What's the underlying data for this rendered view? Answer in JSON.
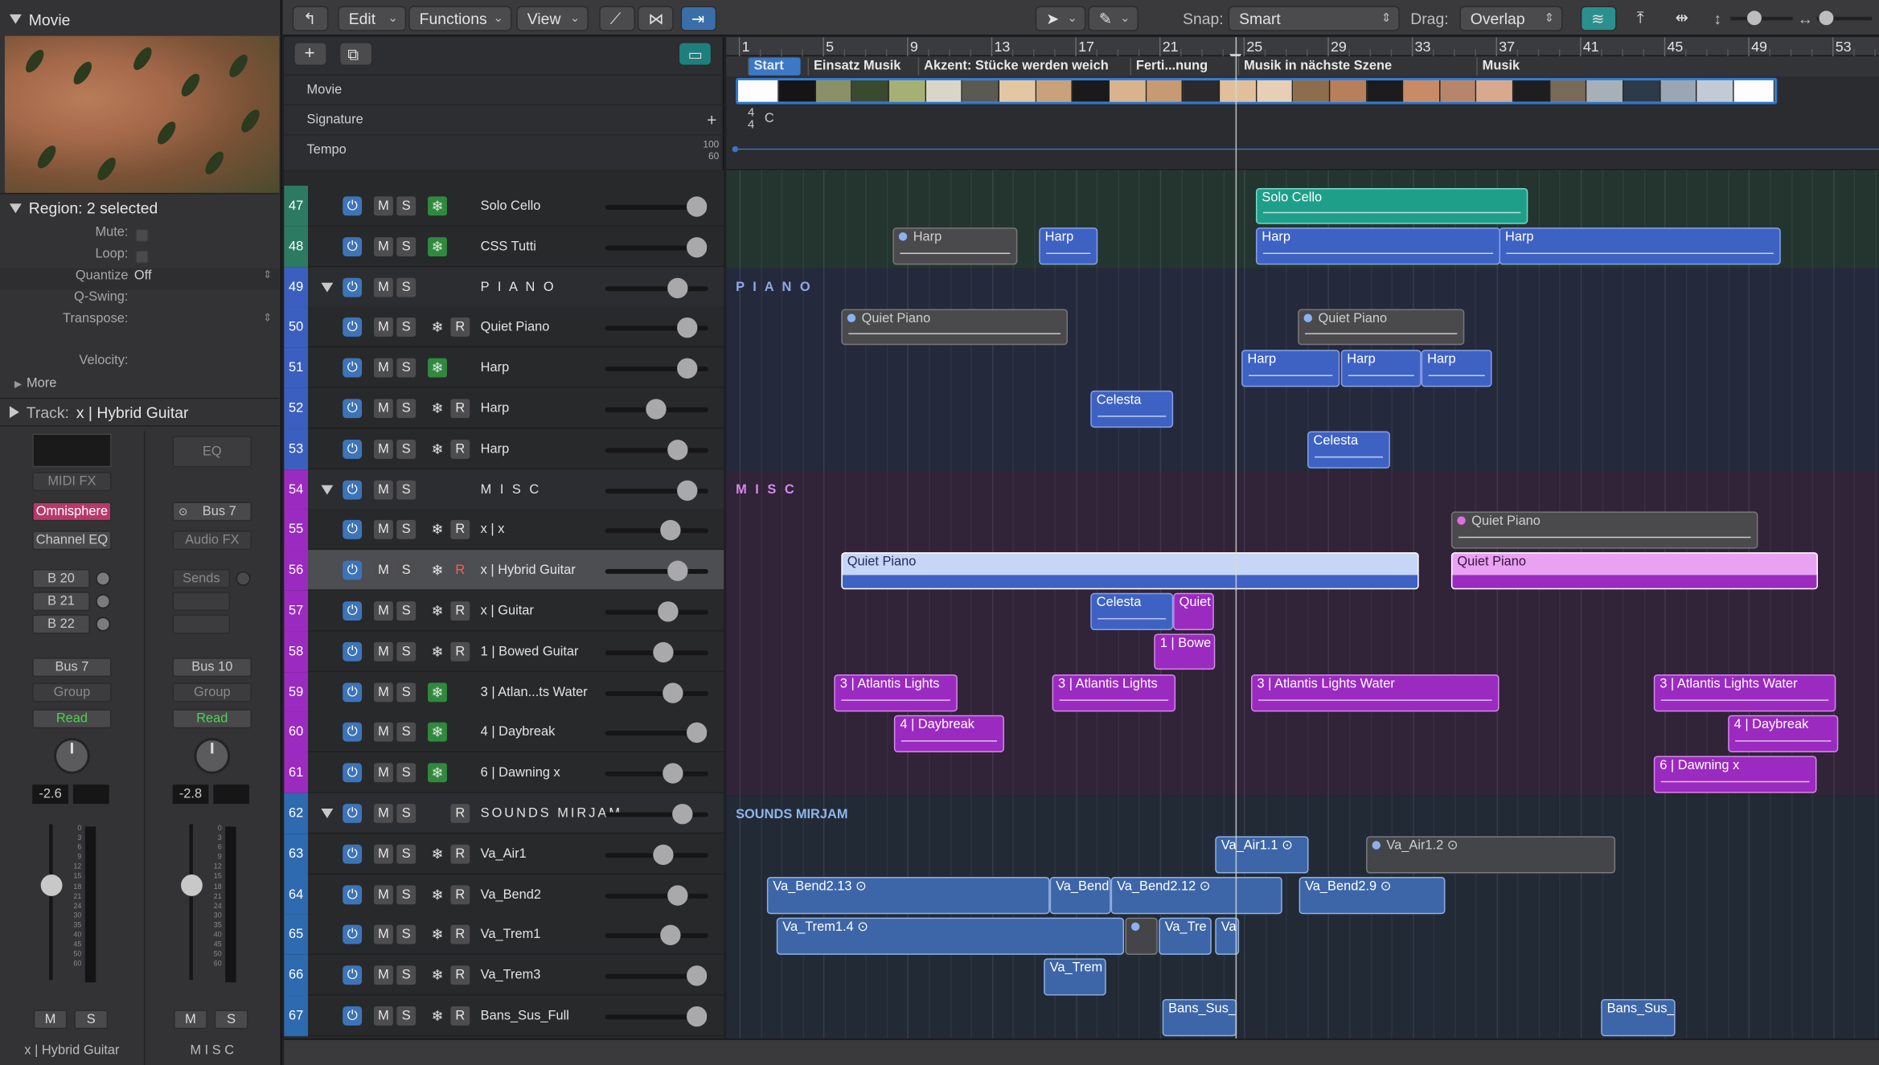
{
  "inspector": {
    "movie_title": "Movie",
    "region_label": "Region: 2 selected",
    "rows": [
      {
        "label": "Mute:",
        "type": "check",
        "value": ""
      },
      {
        "label": "Loop:",
        "type": "check",
        "value": ""
      },
      {
        "label": "Quantize",
        "type": "select",
        "value": "Off"
      },
      {
        "label": "Q-Swing:",
        "type": "text",
        "value": ""
      },
      {
        "label": "Transpose:",
        "type": "select",
        "value": ""
      },
      {
        "label": "Velocity:",
        "type": "text",
        "value": ""
      }
    ],
    "more": "More",
    "track_label": "Track:",
    "track_name": "x | Hybrid Guitar"
  },
  "strip1": {
    "midi_fx": "MIDI FX",
    "instrument": "Omnisphere",
    "channel_eq": "Channel EQ",
    "sends": [
      "B 20",
      "B 21",
      "B 22"
    ],
    "output": "Bus 7",
    "group": "Group",
    "automation": "Read",
    "volume": "-2.6",
    "mute": "M",
    "solo": "S",
    "name": "x | Hybrid Guitar"
  },
  "strip2": {
    "eq": "EQ",
    "input": "Bus 7",
    "audio_fx": "Audio FX",
    "sends": "Sends",
    "output": "Bus 10",
    "group": "Group",
    "automation": "Read",
    "volume": "-2.8",
    "mute": "M",
    "solo": "S",
    "name": "M I S C"
  },
  "fader_scale": [
    "0",
    "3",
    "6",
    "9",
    "12",
    "15",
    "18",
    "21",
    "24",
    "30",
    "35",
    "40",
    "45",
    "50",
    "60"
  ],
  "toolbar": {
    "edit": "Edit",
    "functions": "Functions",
    "view": "View",
    "snap_label": "Snap:",
    "snap_value": "Smart",
    "drag_label": "Drag:",
    "drag_value": "Overlap"
  },
  "global_tracks": {
    "movie": "Movie",
    "signature": "Signature",
    "tempo": "Tempo",
    "tempo_high": "100",
    "tempo_low": "60",
    "sig_num": "4",
    "sig_den": "4",
    "key": "C"
  },
  "ruler": [
    "1",
    "5",
    "9",
    "13",
    "17",
    "21",
    "25",
    "29",
    "33",
    "37",
    "41",
    "45",
    "49",
    "53"
  ],
  "markers": [
    {
      "label": "Start",
      "selected": true
    },
    {
      "label": "Einsatz Musik"
    },
    {
      "label": "Akzent: Stücke werden weich"
    },
    {
      "label": "Ferti...nung"
    },
    {
      "label": "Musik in nächste Szene"
    },
    {
      "label": "Musik"
    }
  ],
  "colors": {
    "strings": "#2d7a62",
    "piano": "#3b5fc0",
    "misc": "#9b2ac1",
    "sounds": "#2d6ab0",
    "power": "#3d74b8",
    "freeze_on": "#2f8a3d"
  },
  "tracks": [
    {
      "num": "47",
      "name": "Solo Cello",
      "color": "#2d7a62",
      "freeze": true,
      "rec": false
    },
    {
      "num": "48",
      "name": "CSS Tutti",
      "color": "#2d7a62",
      "freeze": true,
      "rec": false
    },
    {
      "num": "49",
      "name": "P I A N O",
      "color": "#3b5fc0",
      "folder": true
    },
    {
      "num": "50",
      "name": "Quiet Piano",
      "color": "#3b5fc0",
      "freeze": false,
      "rec": true
    },
    {
      "num": "51",
      "name": "Harp",
      "color": "#3b5fc0",
      "freeze": true,
      "rec": false
    },
    {
      "num": "52",
      "name": "Harp",
      "color": "#3b5fc0",
      "freeze": false,
      "rec": true
    },
    {
      "num": "53",
      "name": "Harp",
      "color": "#3b5fc0",
      "freeze": false,
      "rec": true
    },
    {
      "num": "54",
      "name": "M I S C",
      "color": "#9b2ac1",
      "folder": true
    },
    {
      "num": "55",
      "name": "x | x",
      "color": "#9b2ac1",
      "freeze": false,
      "rec": true
    },
    {
      "num": "56",
      "name": "x | Hybrid Guitar",
      "color": "#9b2ac1",
      "freeze": false,
      "rec": true,
      "selected": true
    },
    {
      "num": "57",
      "name": "x | Guitar",
      "color": "#9b2ac1",
      "freeze": false,
      "rec": true
    },
    {
      "num": "58",
      "name": "1 | Bowed Guitar",
      "color": "#9b2ac1",
      "freeze": false,
      "rec": true
    },
    {
      "num": "59",
      "name": "3 | Atlan...ts Water",
      "color": "#9b2ac1",
      "freeze": true,
      "rec": false
    },
    {
      "num": "60",
      "name": "4 | Daybreak",
      "color": "#9b2ac1",
      "freeze": true,
      "rec": false
    },
    {
      "num": "61",
      "name": "6 | Dawning x",
      "color": "#9b2ac1",
      "freeze": true,
      "rec": false
    },
    {
      "num": "62",
      "name": "SOUNDS MIRJAM",
      "color": "#2d6ab0",
      "folder": true,
      "rec_only": true
    },
    {
      "num": "63",
      "name": "Va_Air1",
      "color": "#2d6ab0",
      "freeze": false,
      "rec": true
    },
    {
      "num": "64",
      "name": "Va_Bend2",
      "color": "#2d6ab0",
      "freeze": false,
      "rec": true
    },
    {
      "num": "65",
      "name": "Va_Trem1",
      "color": "#2d6ab0",
      "freeze": false,
      "rec": true
    },
    {
      "num": "66",
      "name": "Va_Trem3",
      "color": "#2d6ab0",
      "freeze": false,
      "rec": true
    },
    {
      "num": "67",
      "name": "Bans_Sus_Full",
      "color": "#2d6ab0",
      "freeze": false,
      "rec": true
    }
  ],
  "folder_labels": {
    "piano": "P I A N O",
    "misc": "M I S C",
    "sounds": "SOUNDS MIRJAM"
  },
  "regions": [
    {
      "track": 0,
      "label": "Solo Cello",
      "style": "teal"
    },
    {
      "track": 1,
      "label": "Harp",
      "style": "grey"
    },
    {
      "track": 1,
      "label": "Harp",
      "style": "blue"
    },
    {
      "track": 1,
      "label": "Harp",
      "style": "blue"
    },
    {
      "track": 1,
      "label": "Harp",
      "style": "blue"
    },
    {
      "track": 3,
      "label": "Quiet Piano",
      "style": "grey"
    },
    {
      "track": 3,
      "label": "Quiet Piano",
      "style": "grey"
    },
    {
      "track": 4,
      "label": "Harp",
      "style": "blue"
    },
    {
      "track": 4,
      "label": "Harp",
      "style": "blue"
    },
    {
      "track": 4,
      "label": "Harp",
      "style": "blue"
    },
    {
      "track": 5,
      "label": "Celesta",
      "style": "blue"
    },
    {
      "track": 6,
      "label": "Celesta",
      "style": "blue"
    },
    {
      "track": 8,
      "label": "Quiet Piano",
      "style": "grey"
    },
    {
      "track": 9,
      "label": "Quiet Piano",
      "style": "lightblue"
    },
    {
      "track": 9,
      "label": "Quiet Piano",
      "style": "pink"
    },
    {
      "track": 10,
      "label": "Celesta",
      "style": "blue"
    },
    {
      "track": 10,
      "label": "Quiet",
      "style": "purple"
    },
    {
      "track": 11,
      "label": "1 | Bowe",
      "style": "purple"
    },
    {
      "track": 12,
      "label": "3 | Atlantis Lights",
      "style": "purple"
    },
    {
      "track": 12,
      "label": "3 | Atlantis Lights",
      "style": "purple"
    },
    {
      "track": 12,
      "label": "3 | Atlantis Lights Water",
      "style": "purple"
    },
    {
      "track": 12,
      "label": "3 | Atlantis Lights Water",
      "style": "purple"
    },
    {
      "track": 13,
      "label": "4 | Daybreak",
      "style": "purple"
    },
    {
      "track": 13,
      "label": "4 | Daybreak",
      "style": "purple"
    },
    {
      "track": 14,
      "label": "6 | Dawning x",
      "style": "purple"
    },
    {
      "track": 16,
      "label": "Va_Air1.1",
      "style": "audio"
    },
    {
      "track": 16,
      "label": "Va_Air1.2",
      "style": "audiog"
    },
    {
      "track": 17,
      "label": "Va_Bend2.13",
      "style": "audio"
    },
    {
      "track": 17,
      "label": "Va_Bend",
      "style": "audio"
    },
    {
      "track": 17,
      "label": "Va_Bend2.12",
      "style": "audio"
    },
    {
      "track": 17,
      "label": "Va_Bend2.9",
      "style": "audio"
    },
    {
      "track": 18,
      "label": "Va_Trem1.4",
      "style": "audio"
    },
    {
      "track": 18,
      "label": "",
      "style": "audiog"
    },
    {
      "track": 18,
      "label": "Va_Tre",
      "style": "audio"
    },
    {
      "track": 18,
      "label": "Va",
      "style": "audio"
    },
    {
      "track": 19,
      "label": "Va_Trem",
      "style": "audio"
    },
    {
      "track": 20,
      "label": "Bans_Sus_",
      "style": "audio"
    },
    {
      "track": 20,
      "label": "Bans_Sus_",
      "style": "audio"
    }
  ]
}
